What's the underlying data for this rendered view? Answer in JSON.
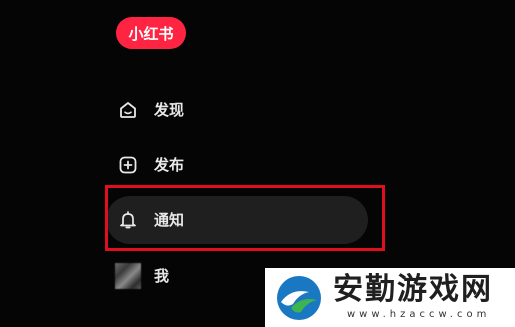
{
  "brand": {
    "logo_text": "小红书",
    "color": "#ff2442"
  },
  "sidebar": {
    "items": [
      {
        "label": "发现",
        "icon": "home-icon"
      },
      {
        "label": "发布",
        "icon": "plus-square-icon"
      },
      {
        "label": "通知",
        "icon": "bell-icon",
        "active": true,
        "highlighted": true
      },
      {
        "label": "我",
        "icon": "avatar"
      }
    ]
  },
  "highlight_color": "#e10f1d",
  "watermark": {
    "title": "安勤游戏网",
    "url": "www.hzaccw.com"
  }
}
